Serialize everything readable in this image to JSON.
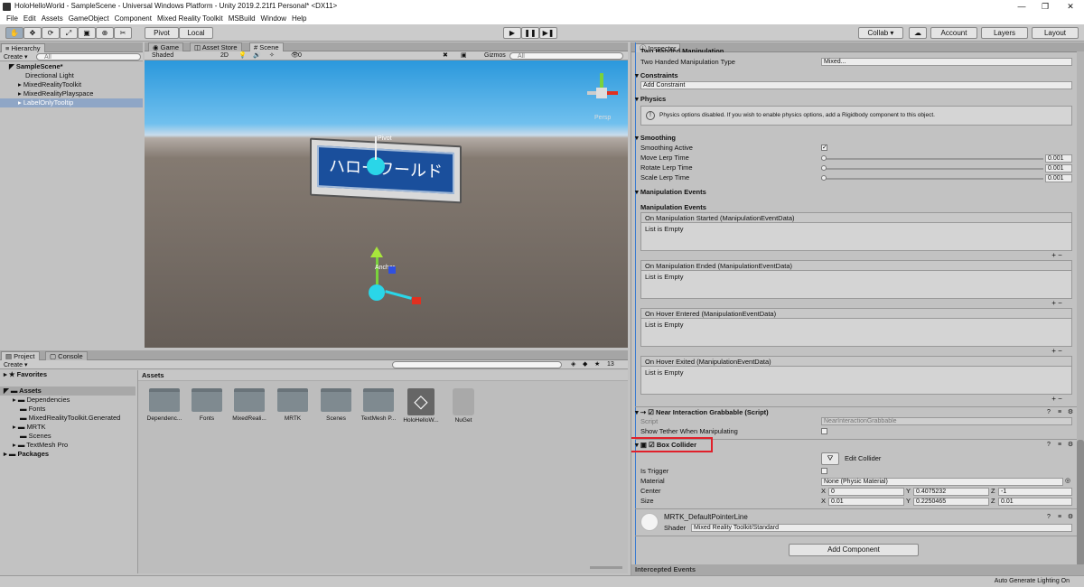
{
  "window": {
    "title": "HoloHelloWorld - SampleScene - Universal Windows Platform - Unity 2019.2.21f1 Personal* <DX11>",
    "min": "—",
    "max": "❐",
    "close": "✕"
  },
  "menu": [
    "File",
    "Edit",
    "Assets",
    "GameObject",
    "Component",
    "Mixed Reality Toolkit",
    "MSBuild",
    "Window",
    "Help"
  ],
  "toolbar": {
    "pivot": "Pivot",
    "local": "Local",
    "collab": "Collab ▾",
    "account": "Account",
    "layers": "Layers",
    "layout": "Layout"
  },
  "hierarchy": {
    "tab": "Hierarchy",
    "create": "Create ▾",
    "search": "All",
    "scene": "SampleScene*",
    "items": [
      "Directional Light",
      "MixedRealityToolkit",
      "MixedRealityPlayspace",
      "LabelOnlyTooltip"
    ]
  },
  "scene_tabs": [
    "Game",
    "Asset Store",
    "Scene"
  ],
  "scene_bar": {
    "shading": "Shaded",
    "mode2d": "2D",
    "gizmos": "Gizmos",
    "search": "All",
    "fx_count": "0"
  },
  "scene": {
    "label_text": "ハローワールド",
    "pivot": "Pivot",
    "anchor": "Anchor",
    "persp": "Persp"
  },
  "project": {
    "tabs": [
      "Project",
      "Console"
    ],
    "create": "Create ▾",
    "favorites": "Favorites",
    "assets_root": "Assets",
    "folders": [
      "Dependencies",
      "Fonts",
      "MixedRealityToolkit.Generated",
      "MRTK",
      "Scenes",
      "TextMesh Pro"
    ],
    "packages": "Packages",
    "assets_header": "Assets",
    "hidden_count": "13",
    "items": [
      "Dependenc...",
      "Fonts",
      "MixedReali...",
      "MRTK",
      "Scenes",
      "TextMesh P...",
      "HoloHelloW...",
      "NuGet"
    ]
  },
  "inspector": {
    "tab": "Inspector",
    "two_handed_header": "Two Handed Manipulation",
    "two_handed_label": "Two Handed Manipulation Type",
    "two_handed_value": "Mixed...",
    "constraints": "Constraints",
    "add_constraint": "Add Constraint",
    "physics": "Physics",
    "physics_msg": "Physics options disabled. If you wish to enable physics options, add a Rigidbody component to this object.",
    "smoothing": "Smoothing",
    "smoothing_rows": [
      {
        "label": "Smoothing Active",
        "value": "✓"
      },
      {
        "label": "Move Lerp Time",
        "value": "0.001"
      },
      {
        "label": "Rotate Lerp Time",
        "value": "0.001"
      },
      {
        "label": "Scale Lerp Time",
        "value": "0.001"
      }
    ],
    "manip_events": "Manipulation Events",
    "manip_events_sub": "Manipulation Events",
    "events": [
      {
        "title": "On Manipulation Started (ManipulationEventData)",
        "body": "List is Empty"
      },
      {
        "title": "On Manipulation Ended (ManipulationEventData)",
        "body": "List is Empty"
      },
      {
        "title": "On Hover Entered (ManipulationEventData)",
        "body": "List is Empty"
      },
      {
        "title": "On Hover Exited (ManipulationEventData)",
        "body": "List is Empty"
      }
    ],
    "near_title": "Near Interaction Grabbable (Script)",
    "script_label": "Script",
    "script_value": "NearInteractionGrabbable",
    "tether_label": "Show Tether When Manipulating",
    "box_title": "Box Collider",
    "edit_collider": "Edit Collider",
    "is_trigger": "Is Trigger",
    "material_label": "Material",
    "material_value": "None (Physic Material)",
    "center_label": "Center",
    "center": {
      "x": "0",
      "y": "0.4075232",
      "z": "-1"
    },
    "size_label": "Size",
    "size": {
      "x": "0.01",
      "y": "0.2250465",
      "z": "0.01"
    },
    "mat_name": "MRTK_DefaultPointerLine",
    "shader_label": "Shader",
    "shader_value": "Mixed Reality Toolkit/Standard",
    "add_component": "Add Component",
    "intercepted": "Intercepted Events"
  },
  "status": {
    "lighting": "Auto Generate Lighting On"
  },
  "colors": {
    "highlight": "#e0202a",
    "scene_label_bg": "#1a4f9c"
  }
}
